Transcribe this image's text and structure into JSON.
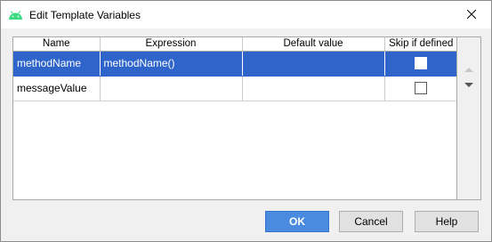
{
  "window": {
    "title": "Edit Template Variables"
  },
  "table": {
    "columns": [
      "Name",
      "Expression",
      "Default value",
      "Skip if defined"
    ],
    "rows": [
      {
        "name": "methodName",
        "expression": "methodName()",
        "default_value": "",
        "skip_if_defined": false,
        "selected": true
      },
      {
        "name": "messageValue",
        "expression": "",
        "default_value": "",
        "skip_if_defined": false,
        "selected": false
      }
    ]
  },
  "buttons": {
    "ok": "OK",
    "cancel": "Cancel",
    "help": "Help"
  },
  "colors": {
    "selection": "#2f65ca",
    "ok_button": "#4a8be0",
    "app_icon": "#3ddc84"
  }
}
